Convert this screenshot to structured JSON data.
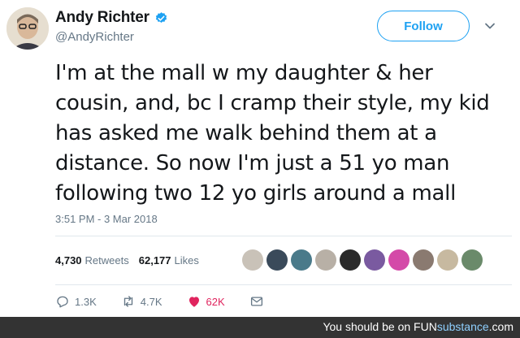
{
  "tweet": {
    "display_name": "Andy Richter",
    "handle": "@AndyRichter",
    "follow_label": "Follow",
    "text": "I'm at the mall w my daughter & her cousin, and, bc I cramp their style, my kid has asked me walk behind them at a distance. So now I'm just a 51 yo man following two 12 yo girls around a mall",
    "timestamp": "3:51 PM - 3 Mar 2018",
    "retweets_count": "4,730",
    "retweets_label": "Retweets",
    "likes_count": "62,177",
    "likes_label": "Likes",
    "liker_avatars": [
      "#c9c2b8",
      "#3a4a5a",
      "#4a7a8a",
      "#b8b0a6",
      "#2b2b2b",
      "#7a5aa0",
      "#d44aa8",
      "#8a7a70",
      "#c7b9a0",
      "#6a8a6a"
    ]
  },
  "actions": {
    "reply_count": "1.3K",
    "retweet_count": "4.7K",
    "like_count": "62K"
  },
  "colors": {
    "accent": "#1da1f2",
    "like": "#e0245e",
    "muted": "#657786"
  },
  "watermark": {
    "prefix": "You should be on ",
    "brand_a": "FUN",
    "brand_b": "substance",
    "suffix": ".com"
  }
}
